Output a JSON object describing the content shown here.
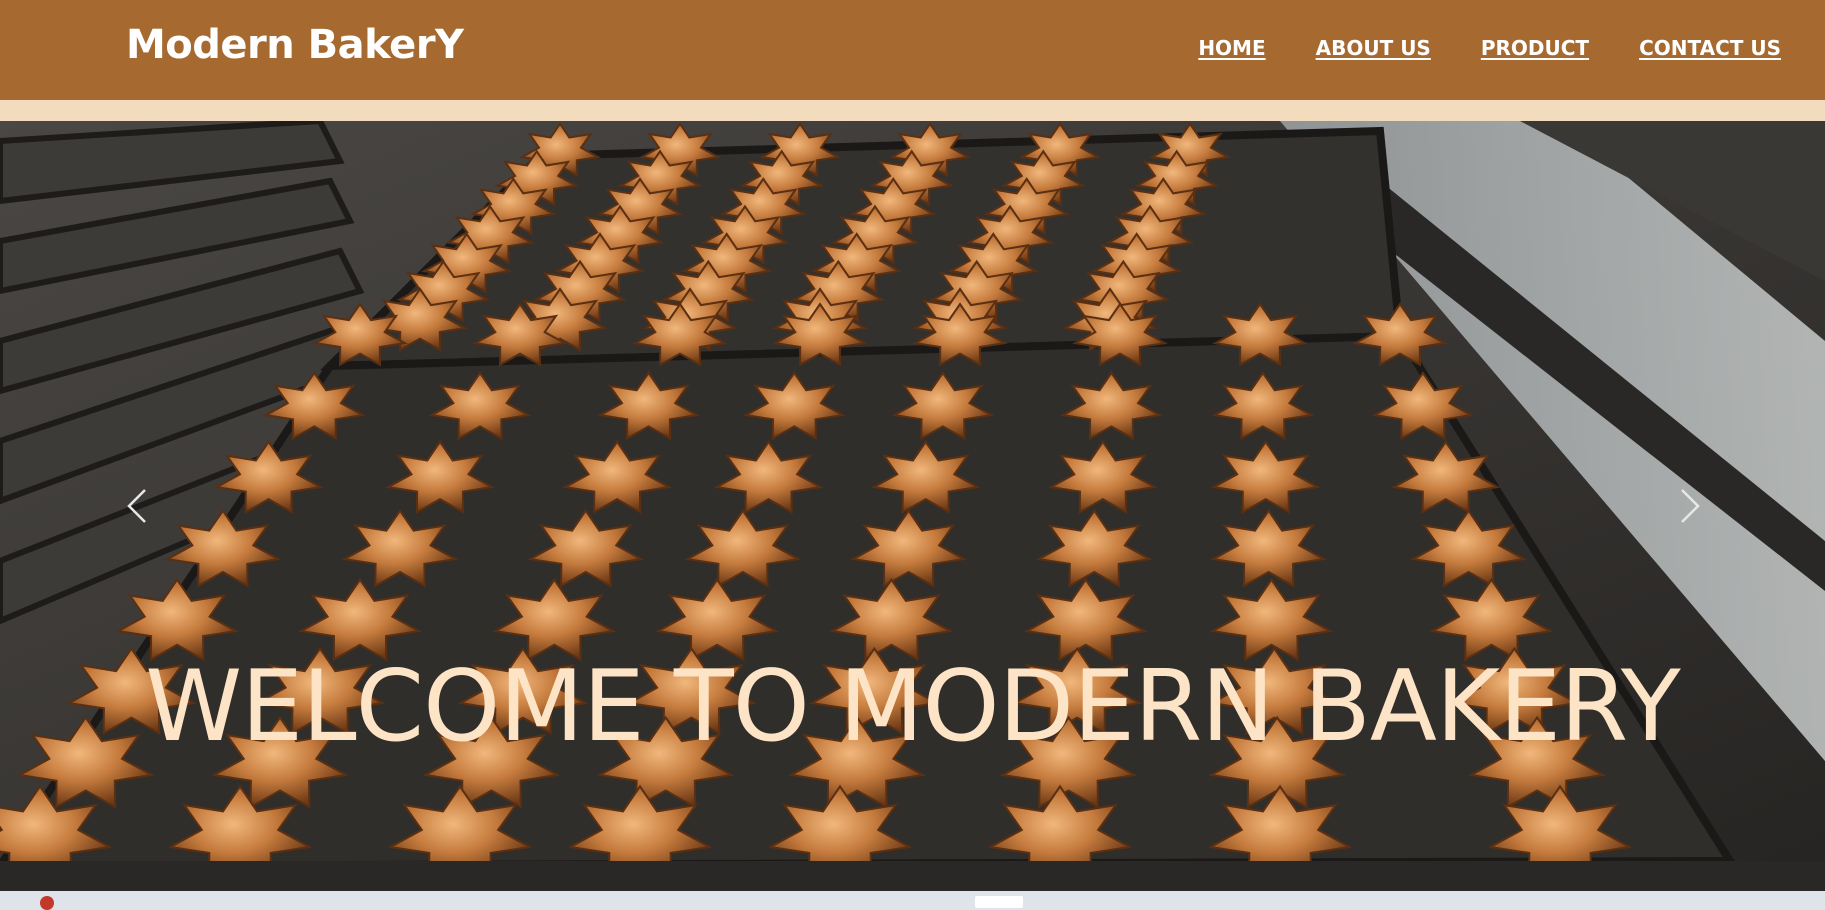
{
  "navbar": {
    "brand": "Modern BakerY",
    "links": [
      {
        "label": "HOME"
      },
      {
        "label": "ABOUT US"
      },
      {
        "label": "PRODUCT"
      },
      {
        "label": "CONTACT US"
      }
    ]
  },
  "hero": {
    "caption": "WELCOME TO MODERN BAKERY",
    "prev_icon": "chevron-left-icon",
    "next_icon": "chevron-right-icon"
  },
  "colors": {
    "navbar_bg": "#a66a31",
    "strip": "#f3dcbd",
    "caption_text": "#fde4c6"
  }
}
